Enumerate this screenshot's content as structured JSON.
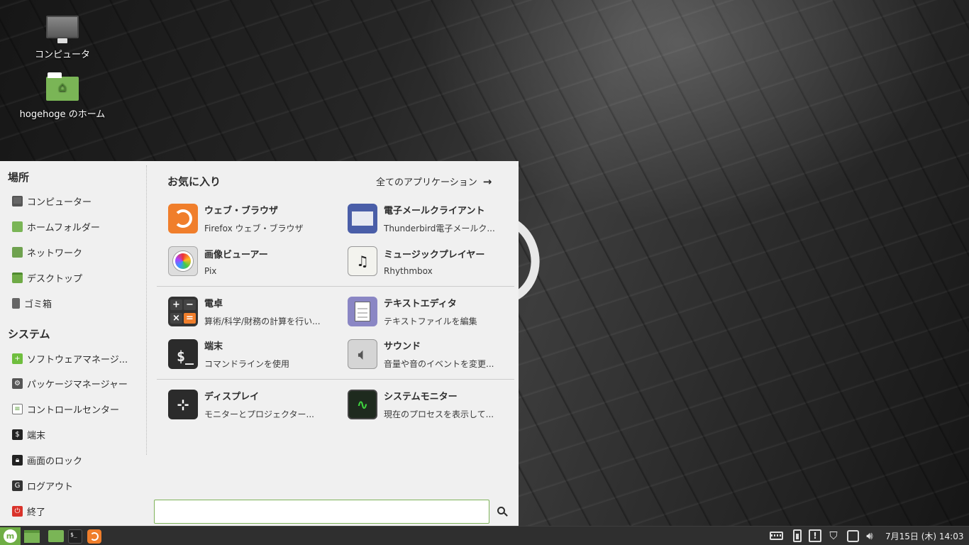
{
  "desktop": {
    "icons": [
      {
        "label": "コンピュータ"
      },
      {
        "label": "hogehoge のホーム"
      }
    ]
  },
  "menu": {
    "places_title": "場所",
    "places": [
      {
        "label": "コンピューター",
        "icon": "computer-icon"
      },
      {
        "label": "ホームフォルダー",
        "icon": "home-folder-icon"
      },
      {
        "label": "ネットワーク",
        "icon": "network-folder-icon"
      },
      {
        "label": "デスクトップ",
        "icon": "desktop-folder-icon"
      },
      {
        "label": "ゴミ箱",
        "icon": "trash-icon"
      }
    ],
    "system_title": "システム",
    "system": [
      {
        "label": "ソフトウェアマネージ...",
        "icon": "software-manager-icon"
      },
      {
        "label": "パッケージマネージャー",
        "icon": "package-manager-icon"
      },
      {
        "label": "コントロールセンター",
        "icon": "control-center-icon"
      },
      {
        "label": "端末",
        "icon": "terminal-icon"
      },
      {
        "label": "画面のロック",
        "icon": "lock-icon"
      },
      {
        "label": "ログアウト",
        "icon": "logout-icon"
      },
      {
        "label": "終了",
        "icon": "power-icon"
      }
    ],
    "favorites_title": "お気に入り",
    "all_apps_label": "全てのアプリケーション",
    "apps": [
      {
        "name": "ウェブ・ブラウザ",
        "desc": "Firefox ウェブ・ブラウザ",
        "icon": "firefox-icon"
      },
      {
        "name": "電子メールクライアント",
        "desc": "Thunderbird電子メールク...",
        "icon": "thunderbird-icon"
      },
      {
        "name": "画像ビューアー",
        "desc": "Pix",
        "icon": "pix-icon"
      },
      {
        "name": "ミュージックプレイヤー",
        "desc": "Rhythmbox",
        "icon": "music-icon"
      },
      {
        "name": "電卓",
        "desc": "算術/科学/財務の計算を行い...",
        "icon": "calculator-icon"
      },
      {
        "name": "テキストエディタ",
        "desc": "テキストファイルを編集",
        "icon": "text-editor-icon"
      },
      {
        "name": "端末",
        "desc": "コマンドラインを使用",
        "icon": "terminal-icon"
      },
      {
        "name": "サウンド",
        "desc": "音量や音のイベントを変更...",
        "icon": "sound-icon"
      },
      {
        "name": "ディスプレイ",
        "desc": "モニターとプロジェクター...",
        "icon": "display-icon"
      },
      {
        "name": "システムモニター",
        "desc": "現在のプロセスを表示して...",
        "icon": "system-monitor-icon"
      }
    ],
    "search": {
      "value": "",
      "placeholder": ""
    }
  },
  "taskbar": {
    "clock": "7月15日 (木) 14:03",
    "terminal_glyph": "$_",
    "menu_glyph": "m"
  },
  "colors": {
    "accent": "#6fae45",
    "menu_bg": "#f0f0f0",
    "panel_bg": "#2f2f2f"
  }
}
